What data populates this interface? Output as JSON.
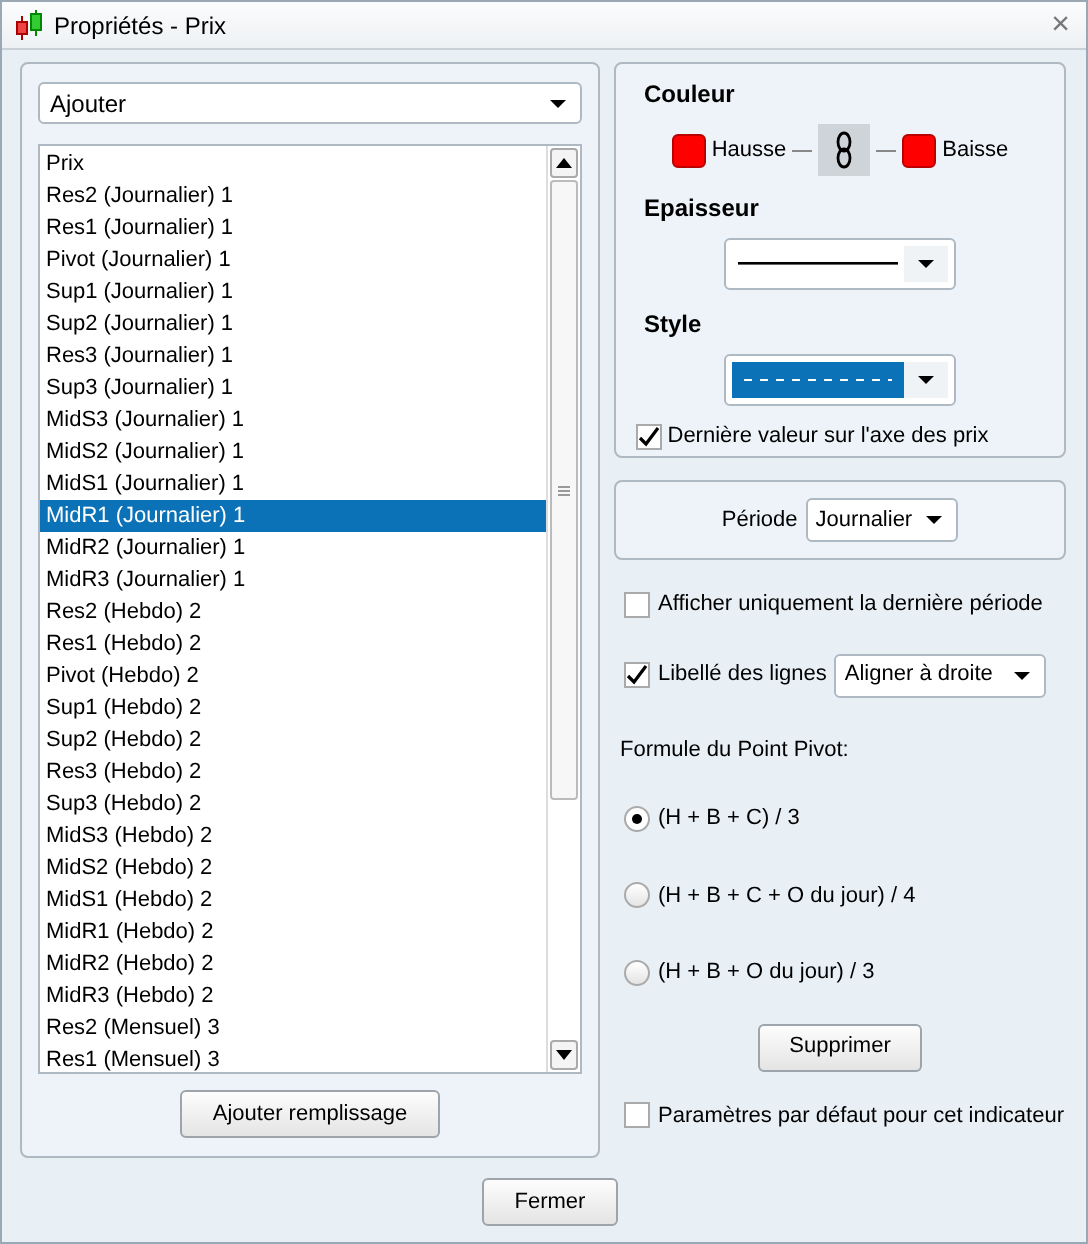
{
  "window": {
    "title": "Propriétés - Prix",
    "close": "×"
  },
  "add_dropdown": {
    "value": "Ajouter"
  },
  "series_list": [
    {
      "label": "Prix",
      "selected": false
    },
    {
      "label": "Res2 (Journalier) 1",
      "selected": false
    },
    {
      "label": "Res1 (Journalier) 1",
      "selected": false
    },
    {
      "label": "Pivot (Journalier) 1",
      "selected": false
    },
    {
      "label": "Sup1 (Journalier) 1",
      "selected": false
    },
    {
      "label": "Sup2 (Journalier) 1",
      "selected": false
    },
    {
      "label": "Res3 (Journalier) 1",
      "selected": false
    },
    {
      "label": "Sup3 (Journalier) 1",
      "selected": false
    },
    {
      "label": "MidS3 (Journalier) 1",
      "selected": false
    },
    {
      "label": "MidS2 (Journalier) 1",
      "selected": false
    },
    {
      "label": "MidS1 (Journalier) 1",
      "selected": false
    },
    {
      "label": "MidR1 (Journalier) 1",
      "selected": true
    },
    {
      "label": "MidR2 (Journalier) 1",
      "selected": false
    },
    {
      "label": "MidR3 (Journalier) 1",
      "selected": false
    },
    {
      "label": "Res2 (Hebdo) 2",
      "selected": false
    },
    {
      "label": "Res1 (Hebdo) 2",
      "selected": false
    },
    {
      "label": "Pivot (Hebdo) 2",
      "selected": false
    },
    {
      "label": "Sup1 (Hebdo) 2",
      "selected": false
    },
    {
      "label": "Sup2 (Hebdo) 2",
      "selected": false
    },
    {
      "label": "Res3 (Hebdo) 2",
      "selected": false
    },
    {
      "label": "Sup3 (Hebdo) 2",
      "selected": false
    },
    {
      "label": "MidS3 (Hebdo) 2",
      "selected": false
    },
    {
      "label": "MidS2 (Hebdo) 2",
      "selected": false
    },
    {
      "label": "MidS1 (Hebdo) 2",
      "selected": false
    },
    {
      "label": "MidR1 (Hebdo) 2",
      "selected": false
    },
    {
      "label": "MidR2 (Hebdo) 2",
      "selected": false
    },
    {
      "label": "MidR3 (Hebdo) 2",
      "selected": false
    },
    {
      "label": "Res2 (Mensuel) 3",
      "selected": false
    },
    {
      "label": "Res1 (Mensuel) 3",
      "selected": false
    }
  ],
  "add_fill_button": "Ajouter remplissage",
  "color_section": {
    "title": "Couleur",
    "up": {
      "label": "Hausse",
      "color": "#ff0000"
    },
    "down": {
      "label": "Baisse",
      "color": "#ff0000"
    },
    "linked": true
  },
  "thickness": {
    "title": "Epaisseur"
  },
  "style": {
    "title": "Style"
  },
  "last_value_axis": {
    "label": "Dernière valeur sur l'axe des prix",
    "checked": true
  },
  "period": {
    "label": "Période",
    "value": "Journalier"
  },
  "last_period_only": {
    "label": "Afficher uniquement la dernière période",
    "checked": false
  },
  "line_labels": {
    "label": "Libellé des lignes",
    "checked": true,
    "value": "Aligner à droite"
  },
  "pivot_formula": {
    "title": "Formule du Point Pivot:",
    "options": [
      {
        "label": "(H + B + C) / 3",
        "selected": true
      },
      {
        "label": "(H + B + C + O du jour) / 4",
        "selected": false
      },
      {
        "label": "(H + B + O du jour) / 3",
        "selected": false
      }
    ]
  },
  "delete_button": "Supprimer",
  "default_params": {
    "label": "Paramètres par défaut pour cet indicateur",
    "checked": false
  },
  "close_button": "Fermer"
}
